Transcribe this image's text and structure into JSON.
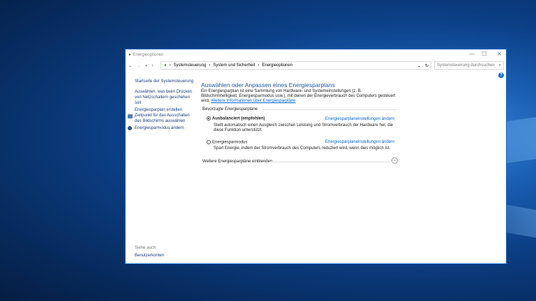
{
  "window": {
    "title": "Energieoptionen",
    "minimize": "—",
    "maximize": "☐",
    "close": "✕"
  },
  "nav": {
    "back": "←",
    "forward": "→",
    "recent": "▾",
    "up": "↑",
    "breadcrumb": [
      "Systemsteuerung",
      "System und Sicherheit",
      "Energieoptionen"
    ],
    "dropdown": "⌄",
    "refresh": "↻",
    "search_placeholder": "Systemsteuerung durchsuchen",
    "search_icon": "⌕",
    "help": "?"
  },
  "sidebar": {
    "items": [
      {
        "label": "Startseite der Systemsteuerung"
      },
      {
        "label": "Auswählen, was beim Drücken von Netzschaltern geschehen soll"
      },
      {
        "label": "Energiesparplan erstellen"
      },
      {
        "label": "Zeitpunkt für das Ausschalten des Bildschirms auswählen",
        "icon": "monitor-icon"
      },
      {
        "label": "Energiesparmodus ändern",
        "icon": "moon-icon"
      }
    ],
    "see_also": "Siehe auch",
    "see_also_link": "Benutzerkonten"
  },
  "main": {
    "title": "Auswählen oder Anpassen eines Energiesparplans",
    "intro": "Ein Energiesparplan ist eine Sammlung von Hardware- und Systemeinstellungen (z. B. Bildschirmhelligkeit, Energiesparmodus usw.), mit denen der Energieverbrauch des Computers gesteuert wird.",
    "intro_link": "Weitere Informationen über Energiesparpläne",
    "group_label": "Bevorzugte Energiesparpläne",
    "plans": [
      {
        "name": "Ausbalanciert (empfohlen)",
        "selected": true,
        "link": "Energiesparplaneinstellungen ändern",
        "desc": "Stellt automatisch einen Ausgleich zwischen Leistung und Stromverbrauch der Hardware her, die diese Funktion unterstützt."
      },
      {
        "name": "Energiesparmodus",
        "selected": false,
        "link": "Energiesparplaneinstellungen ändern",
        "desc": "Spart Energie, indem der Stromverbrauch des Computers reduziert wird, wenn dies möglich ist."
      }
    ],
    "more_plans": "Weitere Energiesparpläne einblenden",
    "expand_icon": "⌄"
  }
}
